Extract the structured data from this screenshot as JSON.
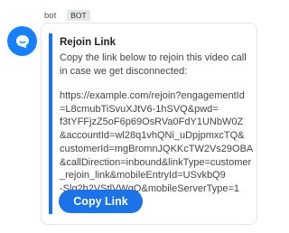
{
  "message": {
    "sender": "bot",
    "badge": "BOT",
    "card": {
      "title": "Rejoin Link",
      "description_lines": [
        "Copy the link below to rejoin this video call",
        "in case we get disconnected:"
      ],
      "link_lines": [
        " https://example.com/rejoin?engagementId",
        "=L8cmubTiSvuXJtV6-1hSVQ&pwd=",
        "f3tYFFjzZ5oF6p69OsRVa0FdY1UNbW0Z",
        "&accountId=wl28q1vhQNi_uDpjpmxcTQ&",
        "customerId=mgBromnJQKKcTW2Vs29OBA",
        "&callDirection=inbound&linkType=customer",
        "_rejoin_link&mobileEntryId=USvkbQ9",
        "-Slq2b2VStlVWgQ&mobileServerType=1"
      ],
      "copy_button_label": "Copy Link"
    }
  },
  "colors": {
    "accent": "#1a73e8",
    "avatar": "#1680ff"
  },
  "icons": {
    "avatar": "chat-bubble-icon"
  }
}
